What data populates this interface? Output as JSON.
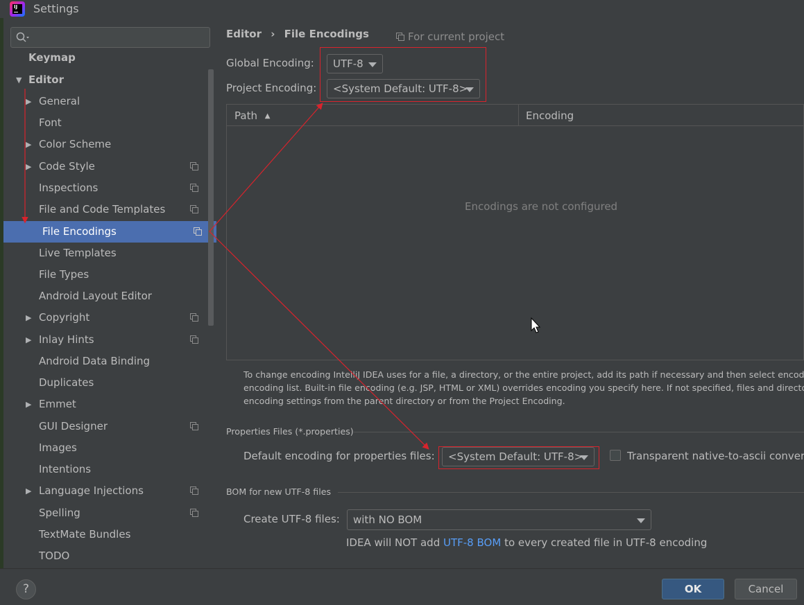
{
  "window": {
    "title": "Settings"
  },
  "search": {
    "placeholder": ""
  },
  "sidebar": {
    "items": [
      {
        "label": "Keymap"
      },
      {
        "label": "Editor"
      },
      {
        "label": "General"
      },
      {
        "label": "Font"
      },
      {
        "label": "Color Scheme"
      },
      {
        "label": "Code Style"
      },
      {
        "label": "Inspections"
      },
      {
        "label": "File and Code Templates"
      },
      {
        "label": "File Encodings"
      },
      {
        "label": "Live Templates"
      },
      {
        "label": "File Types"
      },
      {
        "label": "Android Layout Editor"
      },
      {
        "label": "Copyright"
      },
      {
        "label": "Inlay Hints"
      },
      {
        "label": "Android Data Binding"
      },
      {
        "label": "Duplicates"
      },
      {
        "label": "Emmet"
      },
      {
        "label": "GUI Designer"
      },
      {
        "label": "Images"
      },
      {
        "label": "Intentions"
      },
      {
        "label": "Language Injections"
      },
      {
        "label": "Spelling"
      },
      {
        "label": "TextMate Bundles"
      },
      {
        "label": "TODO"
      }
    ]
  },
  "breadcrumb": {
    "parent": "Editor",
    "separator": "›",
    "current": "File Encodings"
  },
  "scope_note": "For current project",
  "global_encoding": {
    "label": "Global Encoding:",
    "value": "UTF-8"
  },
  "project_encoding": {
    "label": "Project Encoding:",
    "value": "<System Default: UTF-8>"
  },
  "table": {
    "columns": [
      "Path",
      "Encoding"
    ],
    "sort_indicator": "▲",
    "empty_text": "Encodings are not configured"
  },
  "help_text": [
    "To change encoding IntelliJ IDEA uses for a file, a directory, or the entire project, add its path if necessary and then select encoding",
    "encoding list. Built-in file encoding (e.g. JSP, HTML or XML) overrides encoding you specify here. If not specified, files and directorie",
    "encoding settings from the parent directory or from the Project Encoding."
  ],
  "properties": {
    "section_title": "Properties Files (*.properties)",
    "default_label": "Default encoding for properties files:",
    "default_value": "<System Default: UTF-8>",
    "transparent_label": "Transparent native-to-ascii convers"
  },
  "bom": {
    "section_title": "BOM for new UTF-8 files",
    "create_label": "Create UTF-8 files:",
    "create_value": "with NO BOM",
    "note_prefix": "IDEA will NOT add",
    "note_link": "UTF-8 BOM",
    "note_suffix": "to every created file in UTF-8 encoding"
  },
  "buttons": {
    "help": "?",
    "ok": "OK",
    "cancel": "Cancel"
  },
  "colors": {
    "selection": "#4b6eaf",
    "annotation": "#d9232c",
    "link": "#589df6",
    "ok_button": "#365880"
  }
}
